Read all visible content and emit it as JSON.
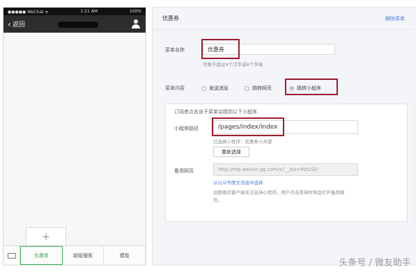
{
  "phone": {
    "status": {
      "carrier": "●●●●● WeChat ᯤ",
      "time": "1:21 AM",
      "battery": "100%"
    },
    "nav": {
      "back_label": "返回"
    },
    "add_label": "+",
    "menu": {
      "items": [
        "优惠券",
        "超级搜索",
        "摸我"
      ]
    }
  },
  "editor": {
    "title": "优惠券",
    "delete_label": "删除菜单",
    "name": {
      "label": "菜单名称",
      "value": "优惠券",
      "hint": "字数不超过4个汉字或8个字母"
    },
    "content": {
      "label": "菜单内容",
      "options": [
        "发送消息",
        "跳转网页",
        "跳转小程序"
      ],
      "selected": "跳转小程序"
    },
    "panel": {
      "desc": "订阅者点击该子菜单会跳到以下小程序",
      "path_label": "小程序路径",
      "path_value": "/pages/index/index",
      "path_hint": "已选择小程序：优惠券小天使",
      "reselect_label": "重新选择",
      "backup_label": "备用网页",
      "backup_value": "http://mp.weixin.qq.com/s?__biz=MzUSO",
      "backup_link": "从公众号图文消息中选择",
      "backup_hint1": "旧版微信客户端无法支持小程序，用户点击菜单时将会打开备用网",
      "backup_hint2": "页。"
    }
  },
  "watermark": "头条号 / 微友助手",
  "colors": {
    "highlight": "#9b1c2c",
    "accent_green": "#3fae52",
    "link_blue": "#4d7bd8"
  }
}
